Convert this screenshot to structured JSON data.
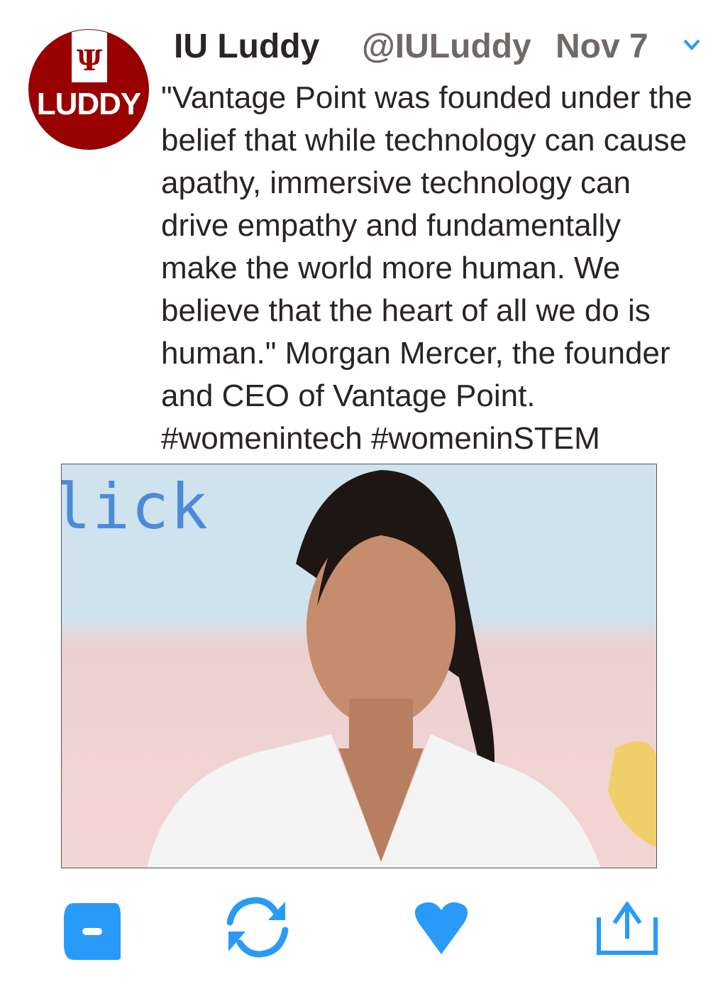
{
  "author": {
    "name": "IU Luddy",
    "handle": "@IULuddy",
    "date": "Nov 7",
    "avatar_text": "LUDDY",
    "avatar_glyph": "Ψ"
  },
  "tweet": {
    "lines": [
      "\"Vantage Point was founded under the",
      "belief that while technology can cause",
      "apathy, immersive technology can",
      "drive empathy and fundamentally",
      "make the world more human. We",
      "believe that the heart of all we do is",
      "human.\" Morgan Mercer, the founder",
      "and CEO of Vantage Point.",
      "#womenintech #womeninSTEM"
    ]
  },
  "image": {
    "sign_text": "lick"
  },
  "actions": [
    "reply-icon",
    "retweet-icon",
    "like-icon",
    "share-icon"
  ],
  "colors": {
    "accent": "#2a9af9",
    "brand": "#990000"
  }
}
